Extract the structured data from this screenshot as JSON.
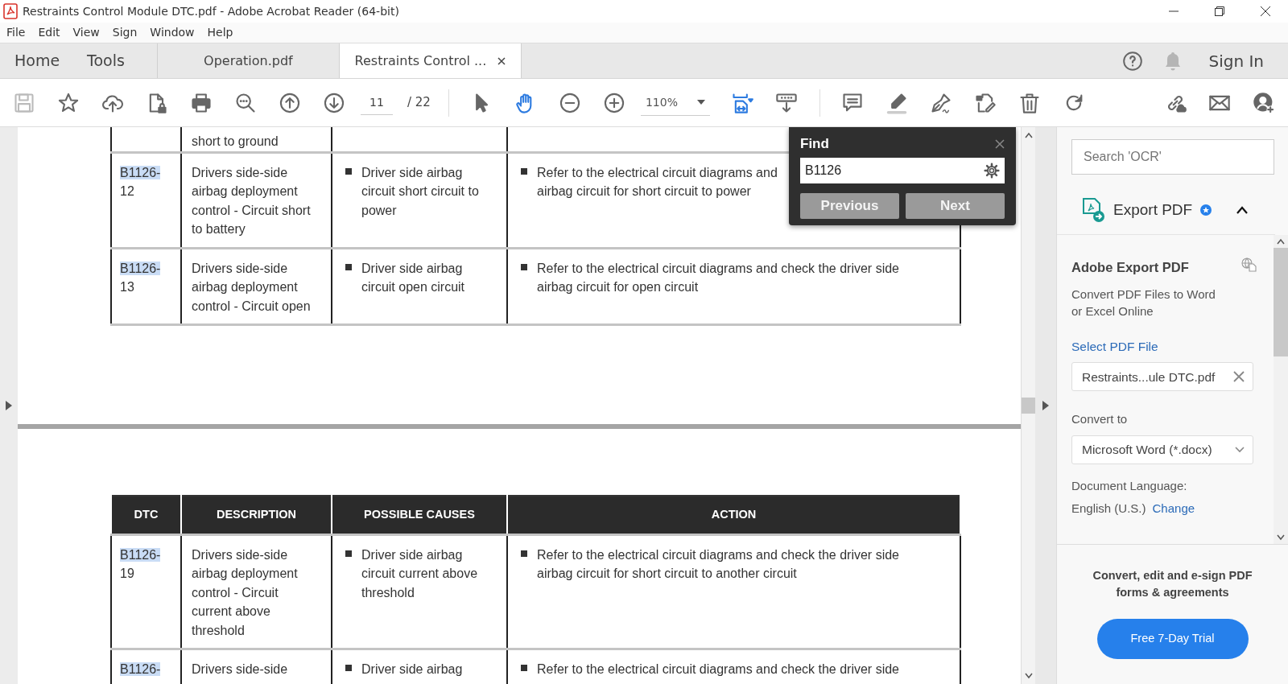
{
  "window": {
    "title": "Restraints Control Module DTC.pdf - Adobe Acrobat Reader (64-bit)"
  },
  "menu": [
    "File",
    "Edit",
    "View",
    "Sign",
    "Window",
    "Help"
  ],
  "nav": [
    "Home",
    "Tools"
  ],
  "tabs": [
    {
      "label": "Operation.pdf",
      "selected": false,
      "closable": false
    },
    {
      "label": "Restraints Control ...",
      "selected": true,
      "closable": true
    }
  ],
  "sign_in": "Sign In",
  "toolbar": {
    "groups": [
      [
        {
          "kind": "icon",
          "disabled": true,
          "selected": false
        },
        {
          "kind": "icon",
          "disabled": false,
          "selected": false
        },
        {
          "kind": "icon",
          "disabled": false,
          "selected": false
        },
        {
          "kind": "icon",
          "disabled": false,
          "selected": false
        },
        {
          "kind": "icon",
          "disabled": false,
          "selected": false
        },
        {
          "kind": "icon",
          "disabled": false,
          "selected": false
        },
        {
          "kind": "icon",
          "disabled": false,
          "selected": false
        },
        {
          "kind": "icon",
          "disabled": false,
          "selected": false
        },
        {
          "kind": "page",
          "value": "11",
          "total": "/ 22"
        }
      ],
      [
        {
          "kind": "icon",
          "disabled": false,
          "selected": false
        },
        {
          "kind": "icon",
          "disabled": false,
          "selected": true
        },
        {
          "kind": "icon",
          "disabled": false,
          "selected": false
        },
        {
          "kind": "icon",
          "disabled": false,
          "selected": false
        },
        {
          "kind": "zoom",
          "value": "110%"
        },
        {
          "kind": "icon",
          "disabled": false,
          "selected": true
        },
        {
          "kind": "icon",
          "disabled": false,
          "selected": false
        }
      ],
      [
        {
          "kind": "icon",
          "disabled": false,
          "selected": false
        },
        {
          "kind": "icon",
          "disabled": false,
          "selected": false
        },
        {
          "kind": "icon",
          "disabled": false,
          "selected": false
        },
        {
          "kind": "icon",
          "disabled": false,
          "selected": false
        },
        {
          "kind": "icon",
          "disabled": false,
          "selected": false
        },
        {
          "kind": "icon",
          "disabled": false,
          "selected": false
        }
      ]
    ],
    "right": [
      {
        "kind": "icon",
        "disabled": false,
        "selected": false
      },
      {
        "kind": "icon",
        "disabled": false,
        "selected": false
      },
      {
        "kind": "icon",
        "disabled": false,
        "selected": false
      }
    ]
  },
  "pages": [
    {
      "rows": [
        {
          "description": "short to ground"
        },
        {
          "dtc_match": "B1126-",
          "dtc_rest": "12",
          "description": "Drivers side-side airbag deployment control - Circuit short to battery",
          "causes": [
            "Driver side airbag circuit short circuit to power"
          ],
          "actions": [
            "Refer to the electrical circuit diagrams and\nairbag circuit for short circuit to power"
          ]
        },
        {
          "dtc_match": "B1126-",
          "dtc_rest": "13",
          "description": "Drivers side-side airbag deployment control - Circuit open",
          "causes": [
            "Driver side airbag circuit open circuit"
          ],
          "actions": [
            "Refer to the electrical circuit diagrams and check the driver side airbag circuit for open circuit"
          ]
        }
      ]
    },
    {
      "columns": [
        "DTC",
        "DESCRIPTION",
        "POSSIBLE CAUSES",
        "ACTION"
      ],
      "rows": [
        {
          "dtc_match": "B1126-",
          "dtc_rest": "19",
          "description": "Drivers side-side airbag deployment control - Circuit current above threshold",
          "causes": [
            "Driver side airbag circuit current above threshold"
          ],
          "actions": [
            "Refer to the electrical circuit diagrams and check the driver side airbag circuit for short circuit to another circuit"
          ]
        },
        {
          "dtc_match": "B1126-",
          "description": "Drivers side-side",
          "causes": [
            "Driver side airbag"
          ],
          "actions": [
            "Refer to the electrical circuit diagrams and check the driver side"
          ]
        }
      ]
    }
  ],
  "find": {
    "title": "Find",
    "query": "B1126",
    "buttons": [
      "Previous",
      "Next"
    ]
  },
  "side_panel": {
    "search": {
      "placeholder": "Search 'OCR'"
    },
    "tool": {
      "title": "Export PDF",
      "expanded": true
    },
    "card": {
      "title": "Adobe Export PDF",
      "description": "Convert PDF Files to Word or Excel Online",
      "select_link": "Select PDF File",
      "file": "Restraints...ule DTC.pdf",
      "convert_label": "Convert to",
      "format": "Microsoft Word (*.docx)",
      "language_label": "Document Language:",
      "language": "English (U.S.)",
      "change_link": "Change"
    },
    "promo": {
      "text": "Convert, edit and e-sign PDF forms & agreements",
      "button": "Free 7-Day Trial"
    }
  }
}
